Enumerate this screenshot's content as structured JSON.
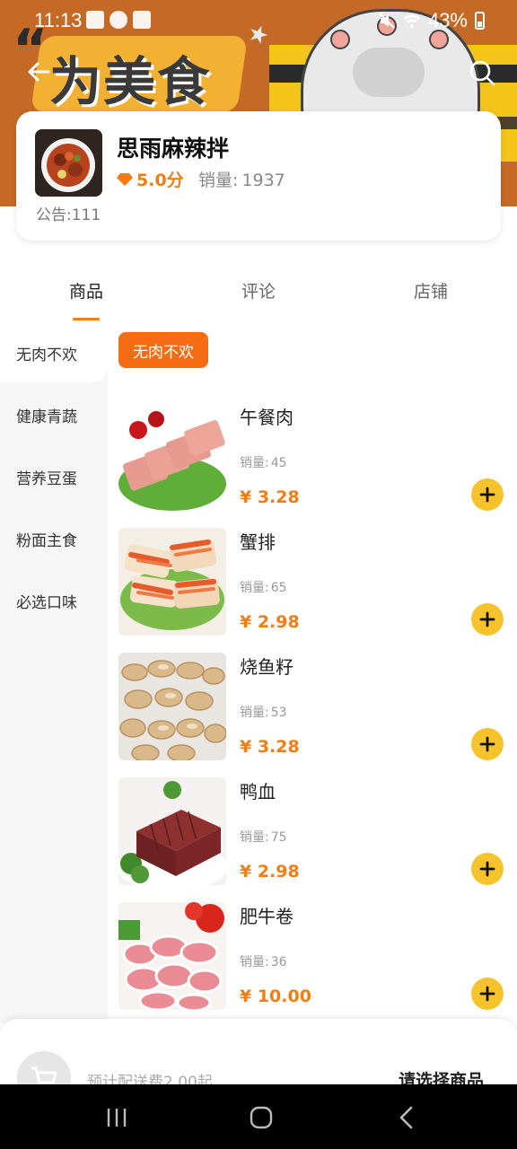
{
  "status_bar": {
    "time": "11:13",
    "battery": "43%"
  },
  "banner": {
    "text": "为美食"
  },
  "shop": {
    "name": "思雨麻辣拌",
    "rating": "5.0分",
    "sales_label": "销量:",
    "sales_value": "1937",
    "notice": "公告:111"
  },
  "tabs": [
    "商品",
    "评论",
    "店铺"
  ],
  "categories": [
    "无肉不欢",
    "健康青蔬",
    "营养豆蛋",
    "粉面主食",
    "必选口味"
  ],
  "active_category": "无肉不欢",
  "products": [
    {
      "name": "午餐肉",
      "sales_label": "销量:",
      "sales": "45",
      "price": "¥ 3.28"
    },
    {
      "name": "蟹排",
      "sales_label": "销量:",
      "sales": "65",
      "price": "¥ 2.98"
    },
    {
      "name": "烧鱼籽",
      "sales_label": "销量:",
      "sales": "53",
      "price": "¥ 3.28"
    },
    {
      "name": "鸭血",
      "sales_label": "销量:",
      "sales": "75",
      "price": "¥ 2.98"
    },
    {
      "name": "肥牛卷",
      "sales_label": "销量:",
      "sales": "36",
      "price": "¥ 10.00"
    }
  ],
  "cart": {
    "delivery_text": "预计配送费2.00起",
    "select_label": "请选择商品"
  },
  "colors": {
    "accent": "#f27d12",
    "chip": "#f66c12",
    "add_button": "#f7c32c",
    "banner": "#c46a26"
  },
  "icons": [
    "back-arrow-icon",
    "search-icon",
    "diamond-icon",
    "plus-icon",
    "cart-icon",
    "recents-icon",
    "home-icon",
    "back-nav-icon"
  ]
}
